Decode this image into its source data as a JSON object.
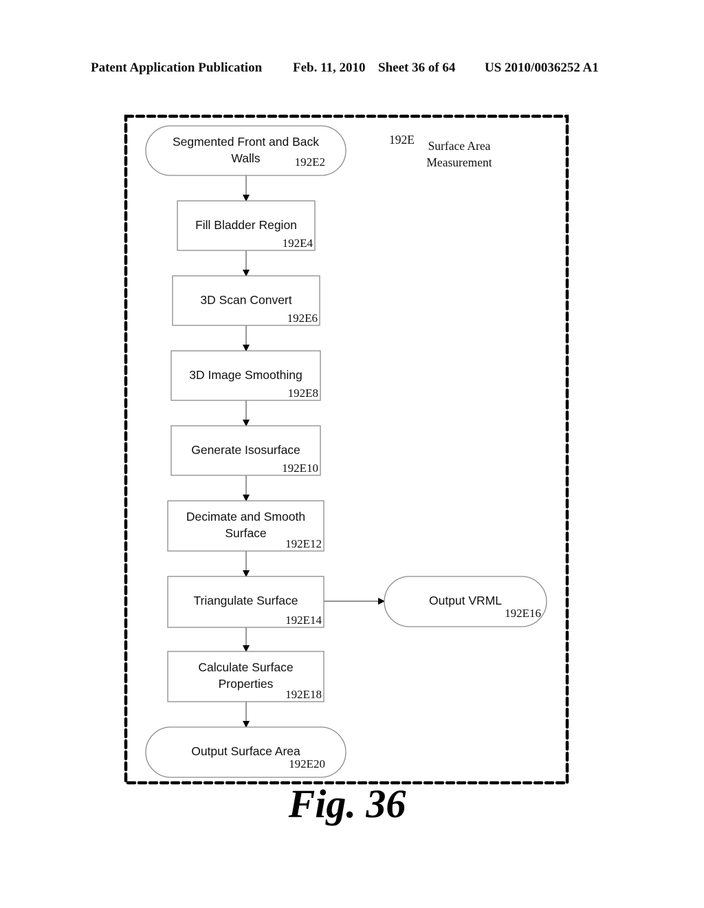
{
  "header": {
    "publication": "Patent Application Publication",
    "date": "Feb. 11, 2010",
    "sheet": "Sheet 36 of 64",
    "patent_number": "US 2010/0036252 A1"
  },
  "diagram": {
    "group_ref": "192E",
    "group_title_line1": "Surface Area",
    "group_title_line2": "Measurement",
    "nodes": [
      {
        "id": "192E2",
        "shape": "terminal",
        "line1": "Segmented Front and Back",
        "line2": "Walls",
        "ref": "192E2"
      },
      {
        "id": "192E4",
        "shape": "process",
        "line1": "Fill Bladder Region",
        "line2": "",
        "ref": "192E4"
      },
      {
        "id": "192E6",
        "shape": "process",
        "line1": "3D Scan Convert",
        "line2": "",
        "ref": "192E6"
      },
      {
        "id": "192E8",
        "shape": "process",
        "line1": "3D Image Smoothing",
        "line2": "",
        "ref": "192E8"
      },
      {
        "id": "192E10",
        "shape": "process",
        "line1": "Generate Isosurface",
        "line2": "",
        "ref": "192E10"
      },
      {
        "id": "192E12",
        "shape": "process",
        "line1": "Decimate and Smooth",
        "line2": "Surface",
        "ref": "192E12"
      },
      {
        "id": "192E14",
        "shape": "process",
        "line1": "Triangulate Surface",
        "line2": "",
        "ref": "192E14"
      },
      {
        "id": "192E16",
        "shape": "terminal",
        "line1": "Output VRML",
        "line2": "",
        "ref": "192E16"
      },
      {
        "id": "192E18",
        "shape": "process",
        "line1": "Calculate Surface",
        "line2": "Properties",
        "ref": "192E18"
      },
      {
        "id": "192E20",
        "shape": "terminal",
        "line1": "Output Surface Area",
        "line2": "",
        "ref": "192E20"
      }
    ],
    "edges": [
      {
        "from": "192E2",
        "to": "192E4"
      },
      {
        "from": "192E4",
        "to": "192E6"
      },
      {
        "from": "192E6",
        "to": "192E8"
      },
      {
        "from": "192E8",
        "to": "192E10"
      },
      {
        "from": "192E10",
        "to": "192E12"
      },
      {
        "from": "192E12",
        "to": "192E14"
      },
      {
        "from": "192E14",
        "to": "192E16"
      },
      {
        "from": "192E14",
        "to": "192E18"
      },
      {
        "from": "192E18",
        "to": "192E20"
      }
    ]
  },
  "figure_caption": "Fig. 36"
}
